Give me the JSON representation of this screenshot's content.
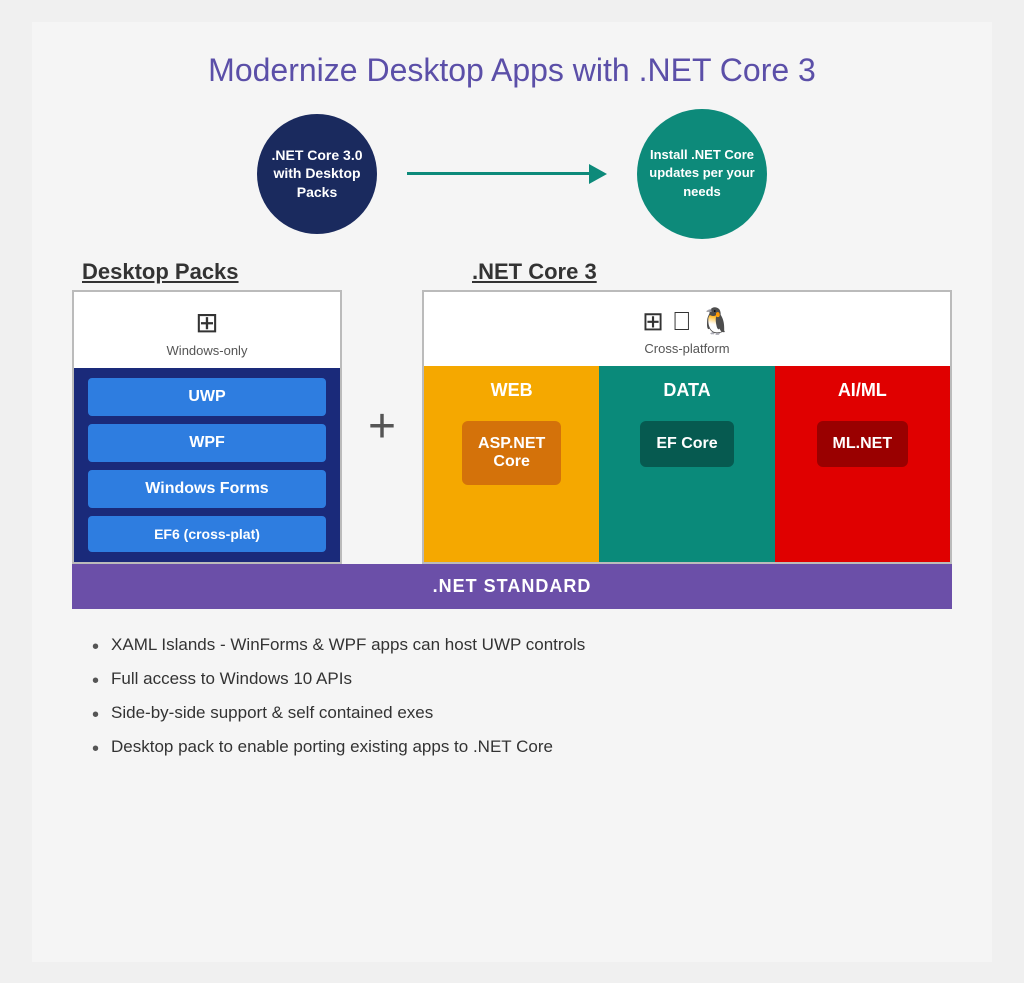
{
  "title": "Modernize Desktop Apps with .NET Core 3",
  "arrow": {
    "left_circle": ".NET Core 3.0 with Desktop Packs",
    "right_circle": "Install .NET Core updates per your needs"
  },
  "desktop_packs": {
    "label": "Desktop Packs",
    "windows_only": "Windows-only",
    "items": [
      "UWP",
      "WPF",
      "Windows Forms",
      "EF6 (cross-plat)"
    ]
  },
  "netcore": {
    "label": ".NET Core 3",
    "cross_platform": "Cross-platform",
    "columns": [
      {
        "header": "WEB",
        "badge": "ASP.NET Core"
      },
      {
        "header": "DATA",
        "badge": "EF Core"
      },
      {
        "header": "AI/ML",
        "badge": "ML.NET"
      }
    ]
  },
  "net_standard_bar": ".NET STANDARD",
  "plus_sign": "+",
  "bullets": [
    "XAML Islands - WinForms & WPF apps can host UWP controls",
    "Full access to Windows 10 APIs",
    "Side-by-side support & self contained exes",
    "Desktop pack to enable porting existing apps to .NET Core"
  ]
}
